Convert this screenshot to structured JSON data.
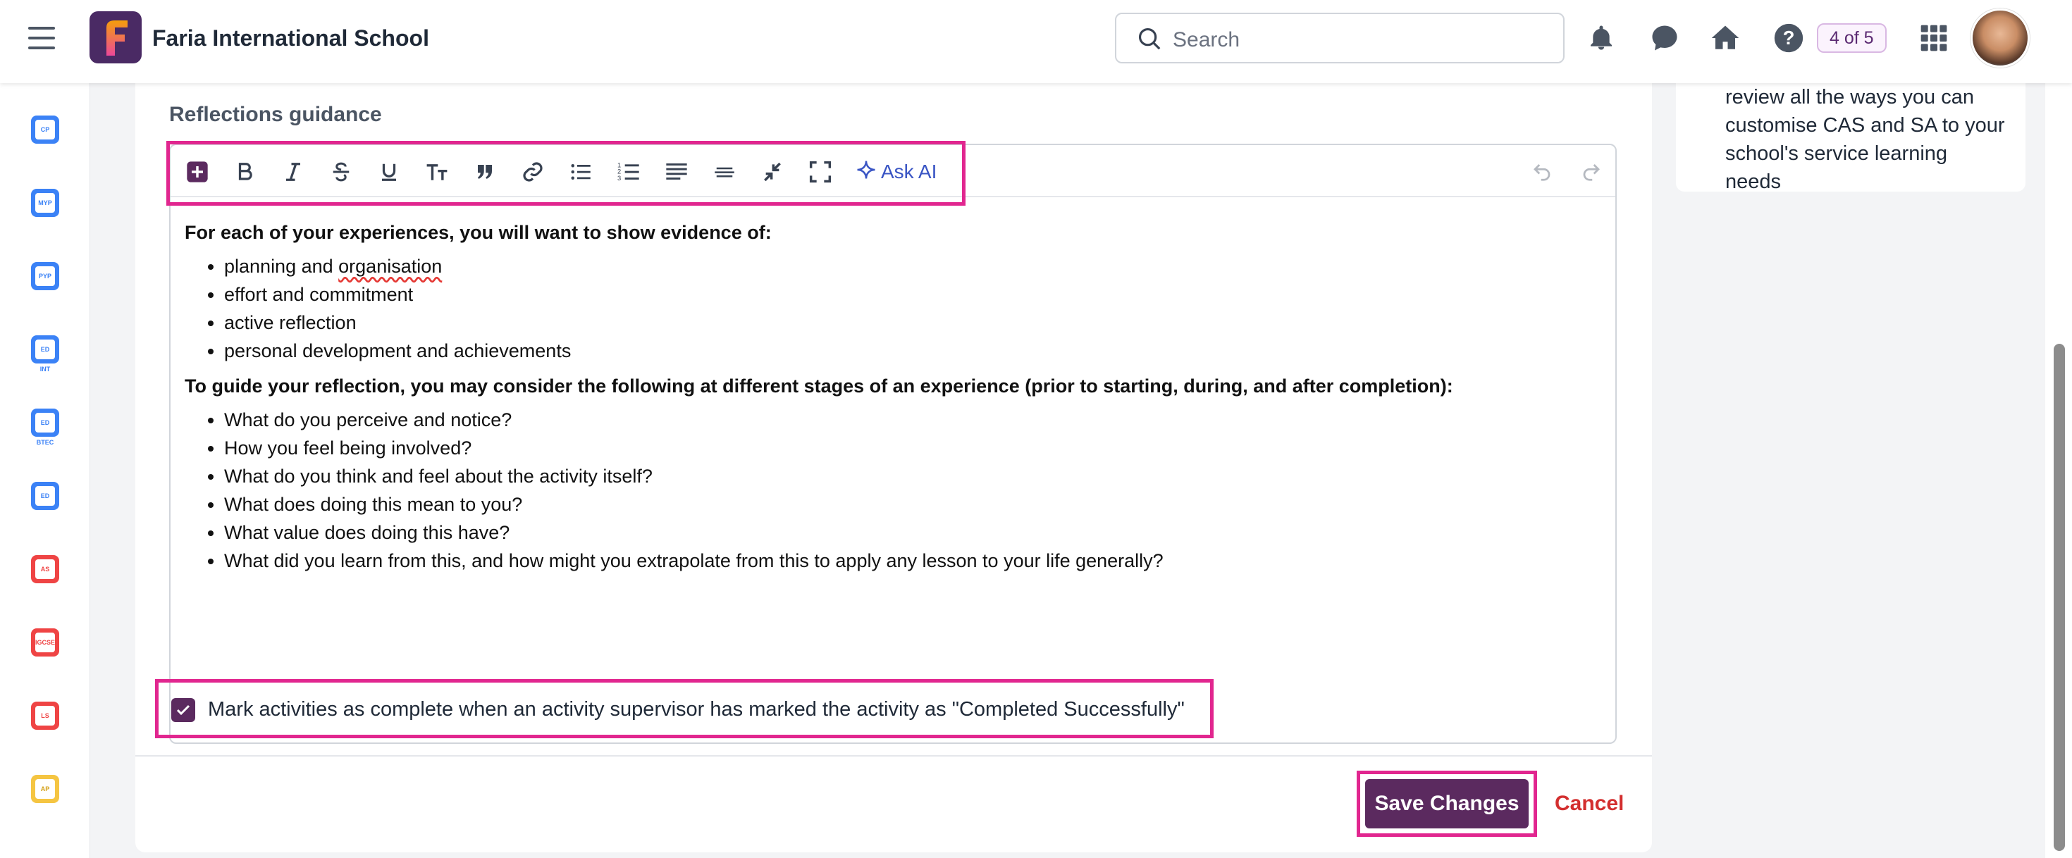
{
  "header": {
    "school_name": "Faria International School",
    "search_placeholder": "Search",
    "progress_badge": "4 of 5",
    "icons": [
      "menu-icon",
      "notification-bell-icon",
      "chat-icon",
      "home-icon",
      "help-icon",
      "apps-grid-icon"
    ]
  },
  "rail": {
    "items": [
      {
        "label": "CP",
        "color": "#3b82f6"
      },
      {
        "label": "MYP",
        "color": "#3b82f6"
      },
      {
        "label": "PYP",
        "color": "#3b82f6"
      },
      {
        "label": "ED INT",
        "color": "#3b82f6"
      },
      {
        "label": "ED BTEC",
        "color": "#3b82f6"
      },
      {
        "label": "ED",
        "color": "#3b82f6"
      },
      {
        "label": "AS",
        "color": "#ef4444"
      },
      {
        "label": "IGCSE",
        "color": "#ef4444"
      },
      {
        "label": "LS",
        "color": "#ef4444"
      },
      {
        "label": "AP",
        "color": "#f5c542"
      }
    ]
  },
  "section": {
    "label": "Reflections guidance"
  },
  "toolbar": {
    "ask_ai": "Ask AI"
  },
  "editor": {
    "heading1": "For each of your experiences, you will want to show evidence of:",
    "list1": [
      "planning and organisation",
      "effort and commitment",
      "active reflection",
      "personal development and achievements"
    ],
    "heading2": "To guide your reflection, you may consider the following at different stages of an experience (prior to starting, during, and after completion):",
    "list2": [
      "What do you perceive and notice?",
      "How you feel being involved?",
      "What do you think and feel about the activity itself?",
      "What does doing this mean to you?",
      "What value does doing this have?",
      "What did you learn from this, and how might you extrapolate from this to apply any lesson to your life generally?"
    ]
  },
  "checkbox": {
    "label": "Mark activities as complete when an activity supervisor has marked the activity as \"Completed Successfully\"",
    "checked": true
  },
  "actions": {
    "save": "Save Changes",
    "cancel": "Cancel"
  },
  "side_panel": {
    "text": "review all the ways you can customise CAS and SA to your school's service learning needs"
  },
  "colors": {
    "brand": "#5b2a5f",
    "highlight": "#e1268f",
    "cancel": "#d32f2f",
    "ai": "#3a55c4"
  }
}
